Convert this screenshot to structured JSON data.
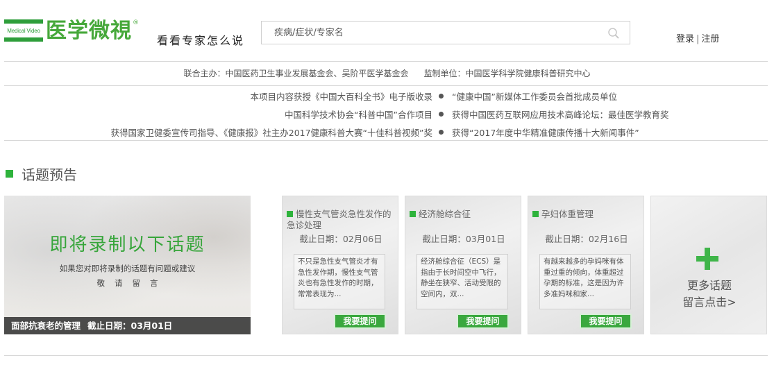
{
  "header": {
    "logo_small": "Medical Video",
    "logo_text": "医学微視",
    "logo_reg": "®",
    "slogan": "看看专家怎么说",
    "search_placeholder": "疾病/症状/专家名",
    "login": "登录",
    "separator": "|",
    "register": "注册"
  },
  "sponsor": {
    "organizers": "联合主办：中国医药卫生事业发展基金会、吴阶平医学基金会",
    "supervisor": "监制单位：中国医学科学院健康科普研究中心"
  },
  "awards": [
    {
      "left": "本项目内容获授《中国大百科全书》电子版收录",
      "right": "“健康中国”新媒体工作委员会首批成员单位"
    },
    {
      "left": "中国科学技术协会“科普中国”合作项目",
      "right": "获得中国医药互联网应用技术高峰论坛：最佳医学教育奖"
    },
    {
      "left": "获得国家卫健委宣传司指导、《健康报》社主办2017健康科普大赛“十佳科普视频”奖",
      "right": "获得“2017年度中华精准健康传播十大新闻事件”"
    }
  ],
  "section": {
    "title": "话题预告"
  },
  "hero": {
    "title": "即将录制以下话题",
    "subtitle": "如果您对即将录制的话题有问题或建议",
    "subtitle2": "敬请留言",
    "topic": "面部抗衰老的管理",
    "deadline": "截止日期：03月01日"
  },
  "cards": [
    {
      "title": "慢性支气管炎急性发作的急诊处理",
      "date": "截止日期：02月06日",
      "desc": "不只是急性支气管炎才有急性发作期，慢性支气管炎也有急性发作的时期，常常表现为...",
      "button": "我要提问"
    },
    {
      "title": "经济舱综合征",
      "date": "截止日期：03月01日",
      "desc": "经济舱综合征（ECS）是指由于长时间空中飞行，静坐在狭窄、活动受限的空间内，双...",
      "button": "我要提问"
    },
    {
      "title": "孕妇体重管理",
      "date": "截止日期：02月16日",
      "desc": "有越来越多的孕妈咪有体重过重的倾向，体重超过孕期的标准，这是因为许多准妈咪和家...",
      "button": "我要提问"
    }
  ],
  "more": {
    "line1": "更多话题",
    "line2": "留言点击>"
  },
  "colors": {
    "brand_green": "#46a83a",
    "button_green": "#3aa83e",
    "marker_green": "#2eb33c"
  }
}
